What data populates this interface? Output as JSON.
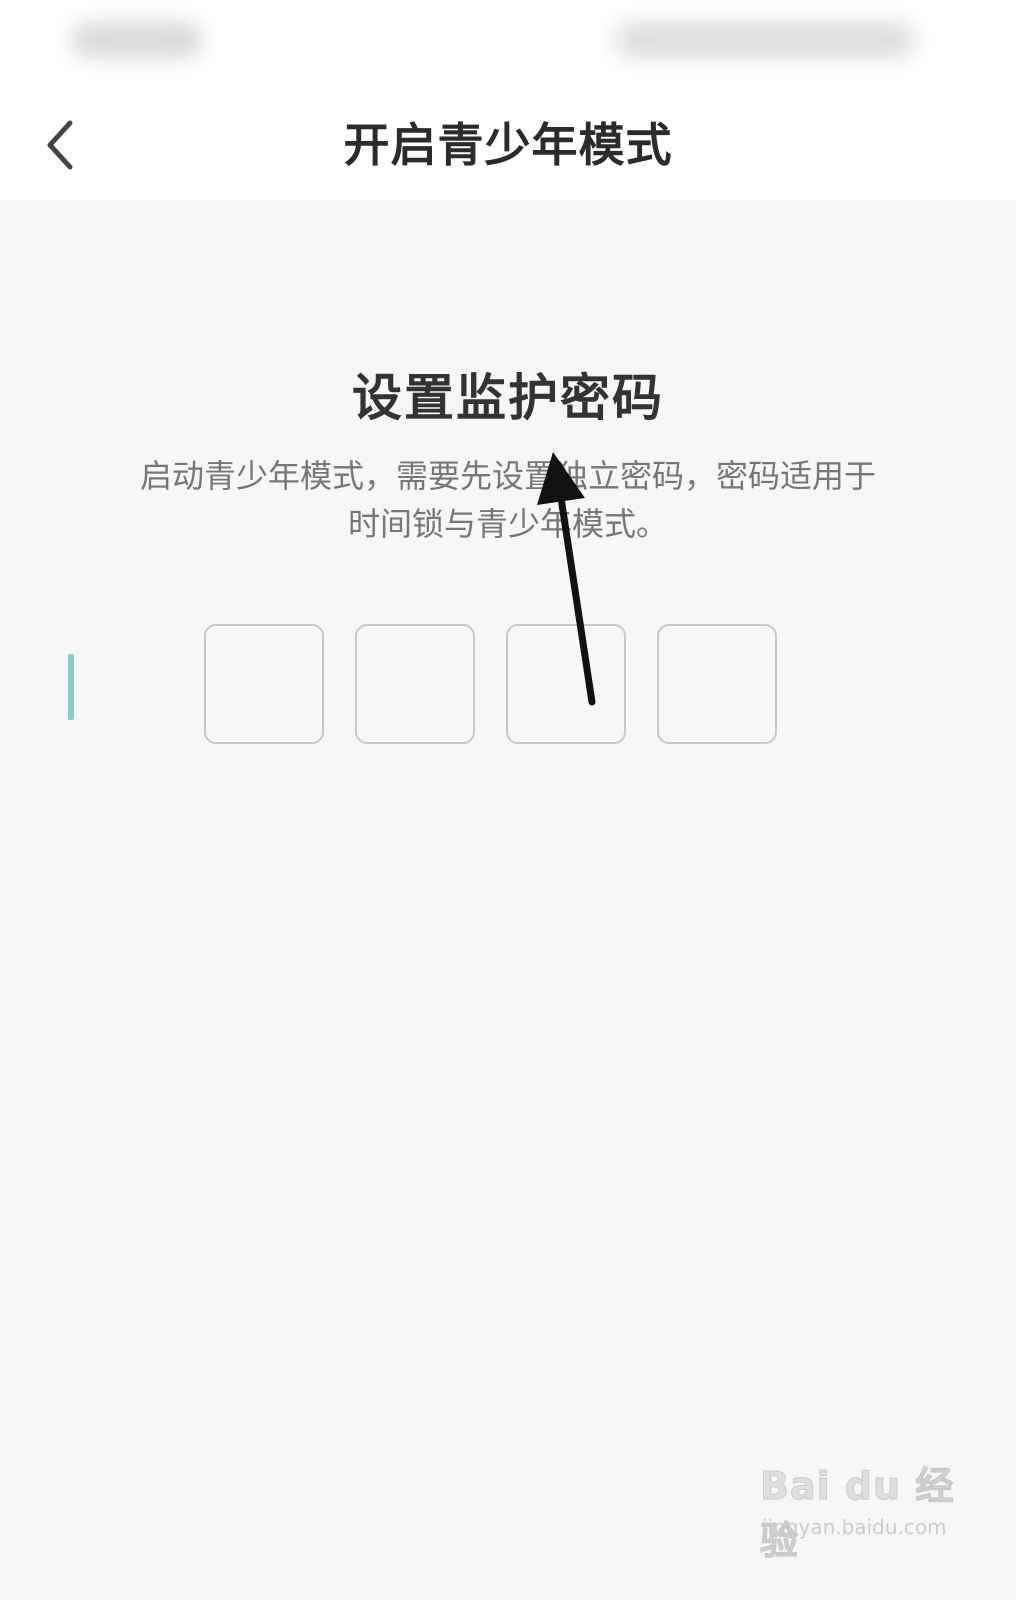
{
  "nav": {
    "title": "开启青少年模式",
    "back_icon": "chevron-left-icon"
  },
  "main": {
    "heading": "设置监护密码",
    "description": "启动青少年模式，需要先设置独立密码，密码适用于时间锁与青少年模式。",
    "code_boxes": [
      "",
      "",
      "",
      ""
    ]
  },
  "watermark": {
    "logo": "Bai du 经验",
    "url": "jingyan.baidu.com"
  },
  "colors": {
    "cursor": "#86cfc8",
    "background": "#f7f7f7",
    "header": "#ffffff"
  }
}
